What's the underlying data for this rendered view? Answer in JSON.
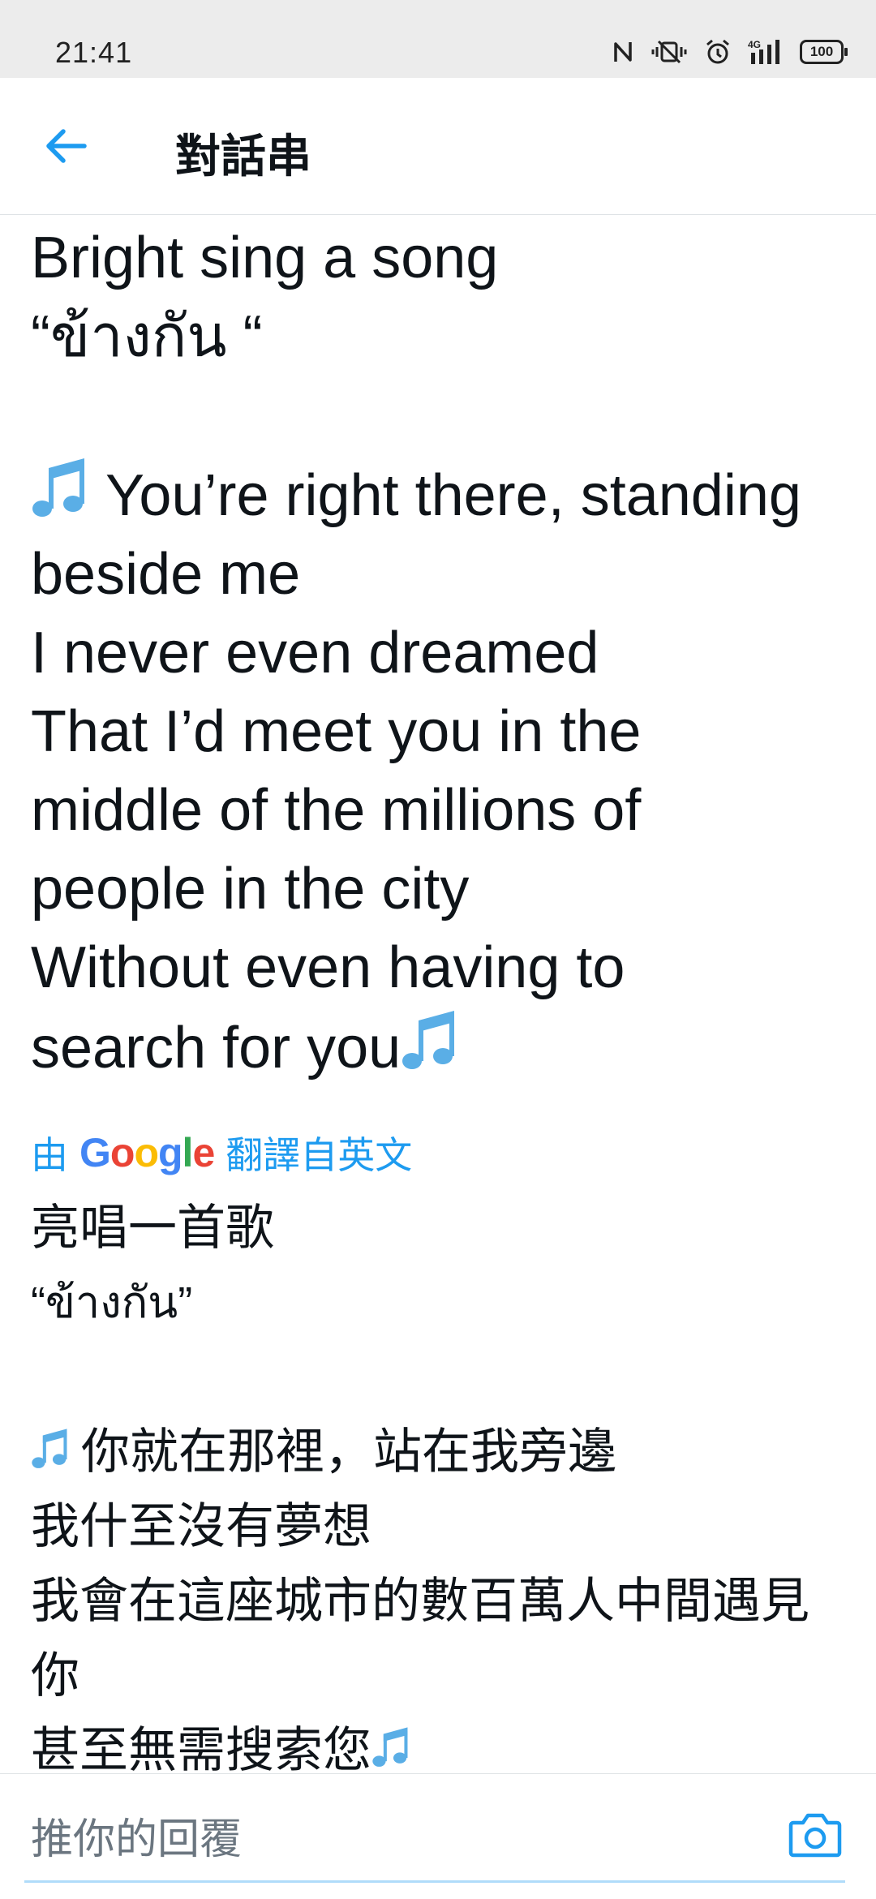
{
  "status_bar": {
    "time": "21:41",
    "network": "4G",
    "battery": "100",
    "icons": [
      "nfc-icon",
      "vibrate-icon",
      "alarm-icon",
      "signal-icon",
      "battery-icon"
    ]
  },
  "header": {
    "back_icon": "arrow-left-icon",
    "title": "對話串"
  },
  "tweet": {
    "line1": "Bright sing a song",
    "line2": "“ข้างกัน “",
    "line3": "You’re right there, standing",
    "line4": "beside me",
    "line5": "I never even dreamed",
    "line6": "That I’d meet you in the",
    "line7": "middle of the millions of",
    "line8": "people in the city",
    "line9": "Without even having to",
    "line10": "search for you"
  },
  "translation_label": {
    "prefix": "由",
    "brand": "Google",
    "suffix": "翻譯自英文"
  },
  "translation": {
    "line1": "亮唱一首歌",
    "line2": "“ข้างกัน”",
    "line3": "你就在那裡，站在我旁邊",
    "line4": "我什至沒有夢想",
    "line5": "我會在這座城市的數百萬人中間遇見",
    "line6": "你",
    "line7": "甚至無需搜索您"
  },
  "reply_bar": {
    "placeholder": "推你的回覆",
    "camera_icon": "camera-icon"
  },
  "colors": {
    "accent": "#1d9bf0",
    "text": "#0f1419",
    "status_bar_bg": "#ececec"
  }
}
